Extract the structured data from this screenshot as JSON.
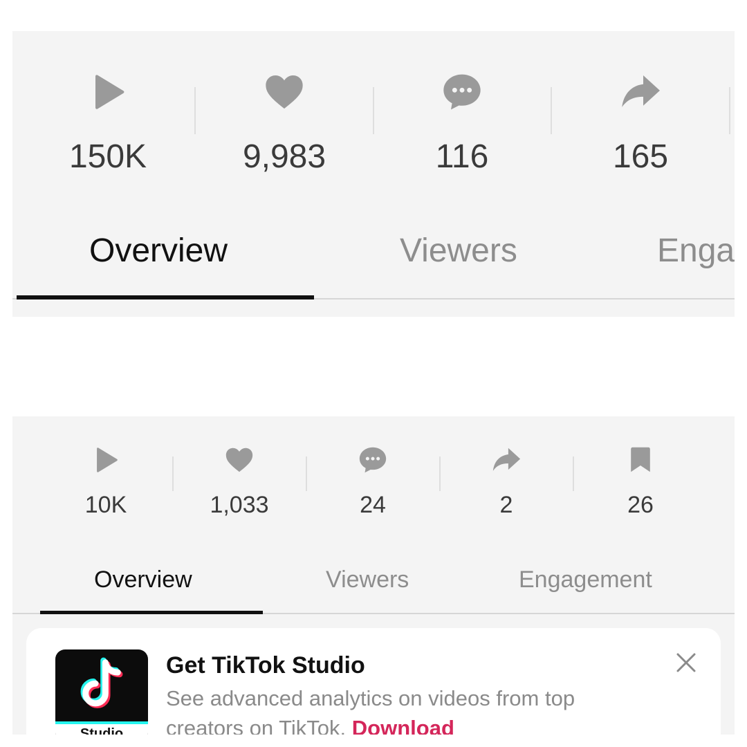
{
  "top_panel": {
    "stats": [
      {
        "icon": "play-icon",
        "value": "150K"
      },
      {
        "icon": "heart-icon",
        "value": "9,983"
      },
      {
        "icon": "comment-icon",
        "value": "116"
      },
      {
        "icon": "share-icon",
        "value": "165"
      }
    ],
    "tabs": [
      {
        "label": "Overview",
        "active": true
      },
      {
        "label": "Viewers",
        "active": false
      },
      {
        "label": "Enga",
        "active": false
      }
    ]
  },
  "bottom_panel": {
    "stats": [
      {
        "icon": "play-icon",
        "value": "10K"
      },
      {
        "icon": "heart-icon",
        "value": "1,033"
      },
      {
        "icon": "comment-icon",
        "value": "24"
      },
      {
        "icon": "share-icon",
        "value": "2"
      },
      {
        "icon": "bookmark-icon",
        "value": "26"
      }
    ],
    "tabs": [
      {
        "label": "Overview",
        "active": true
      },
      {
        "label": "Viewers",
        "active": false
      },
      {
        "label": "Engagement",
        "active": false
      }
    ],
    "promo": {
      "icon_label": "Studio",
      "title": "Get TikTok Studio",
      "description": "See advanced analytics on videos from top creators on TikTok.",
      "link": "Download"
    }
  },
  "colors": {
    "panel_bg": "#f4f4f4",
    "icon_gray": "#9a9a9a",
    "active_text": "#111111",
    "inactive_text": "#8d8d8d",
    "link": "#d4265a",
    "tiktok_cyan": "#25f4ee",
    "tiktok_red": "#fe2c55"
  }
}
